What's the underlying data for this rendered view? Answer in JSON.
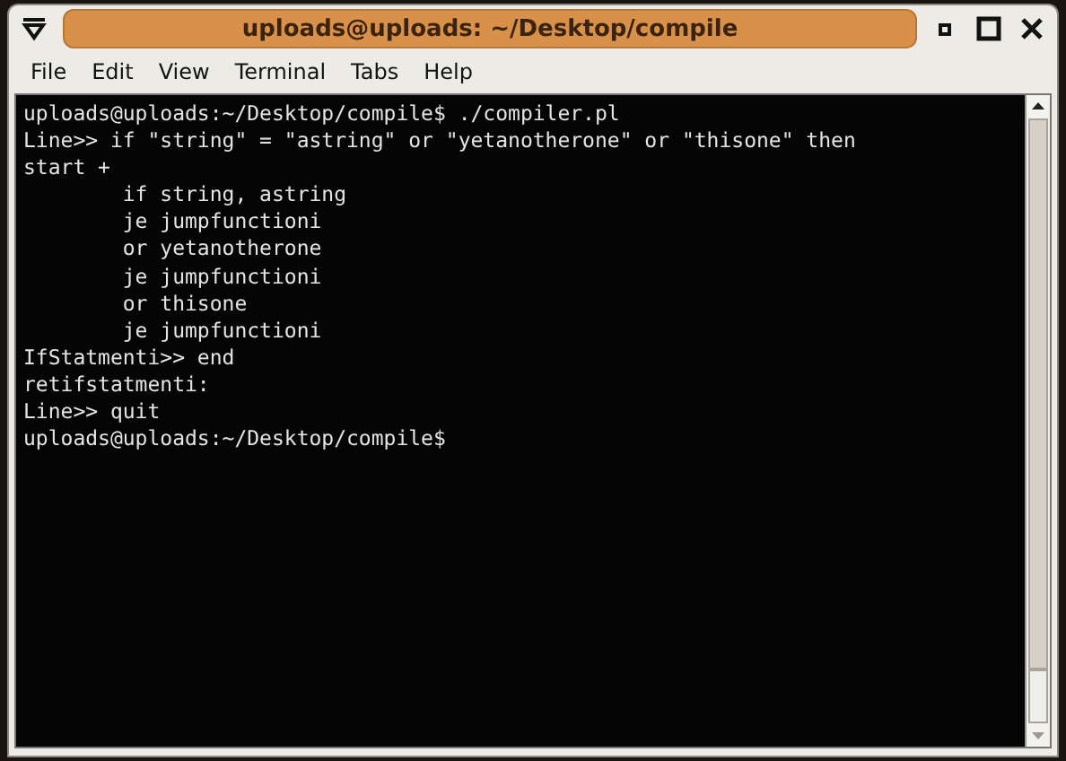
{
  "window": {
    "title": "uploads@uploads: ~/Desktop/compile"
  },
  "menu": [
    {
      "label": "File"
    },
    {
      "label": "Edit"
    },
    {
      "label": "View"
    },
    {
      "label": "Terminal"
    },
    {
      "label": "Tabs"
    },
    {
      "label": "Help"
    }
  ],
  "terminal": {
    "lines": [
      "uploads@uploads:~/Desktop/compile$ ./compiler.pl",
      "Line>> if \"string\" = \"astring\" or \"yetanotherone\" or \"thisone\" then",
      "start +",
      "        if string, astring",
      "        je jumpfunctioni",
      "        or yetanotherone",
      "        je jumpfunctioni",
      "        or thisone",
      "        je jumpfunctioni",
      "IfStatmenti>> end",
      "retifstatmenti:",
      "Line>> quit",
      "uploads@uploads:~/Desktop/compile$"
    ]
  }
}
